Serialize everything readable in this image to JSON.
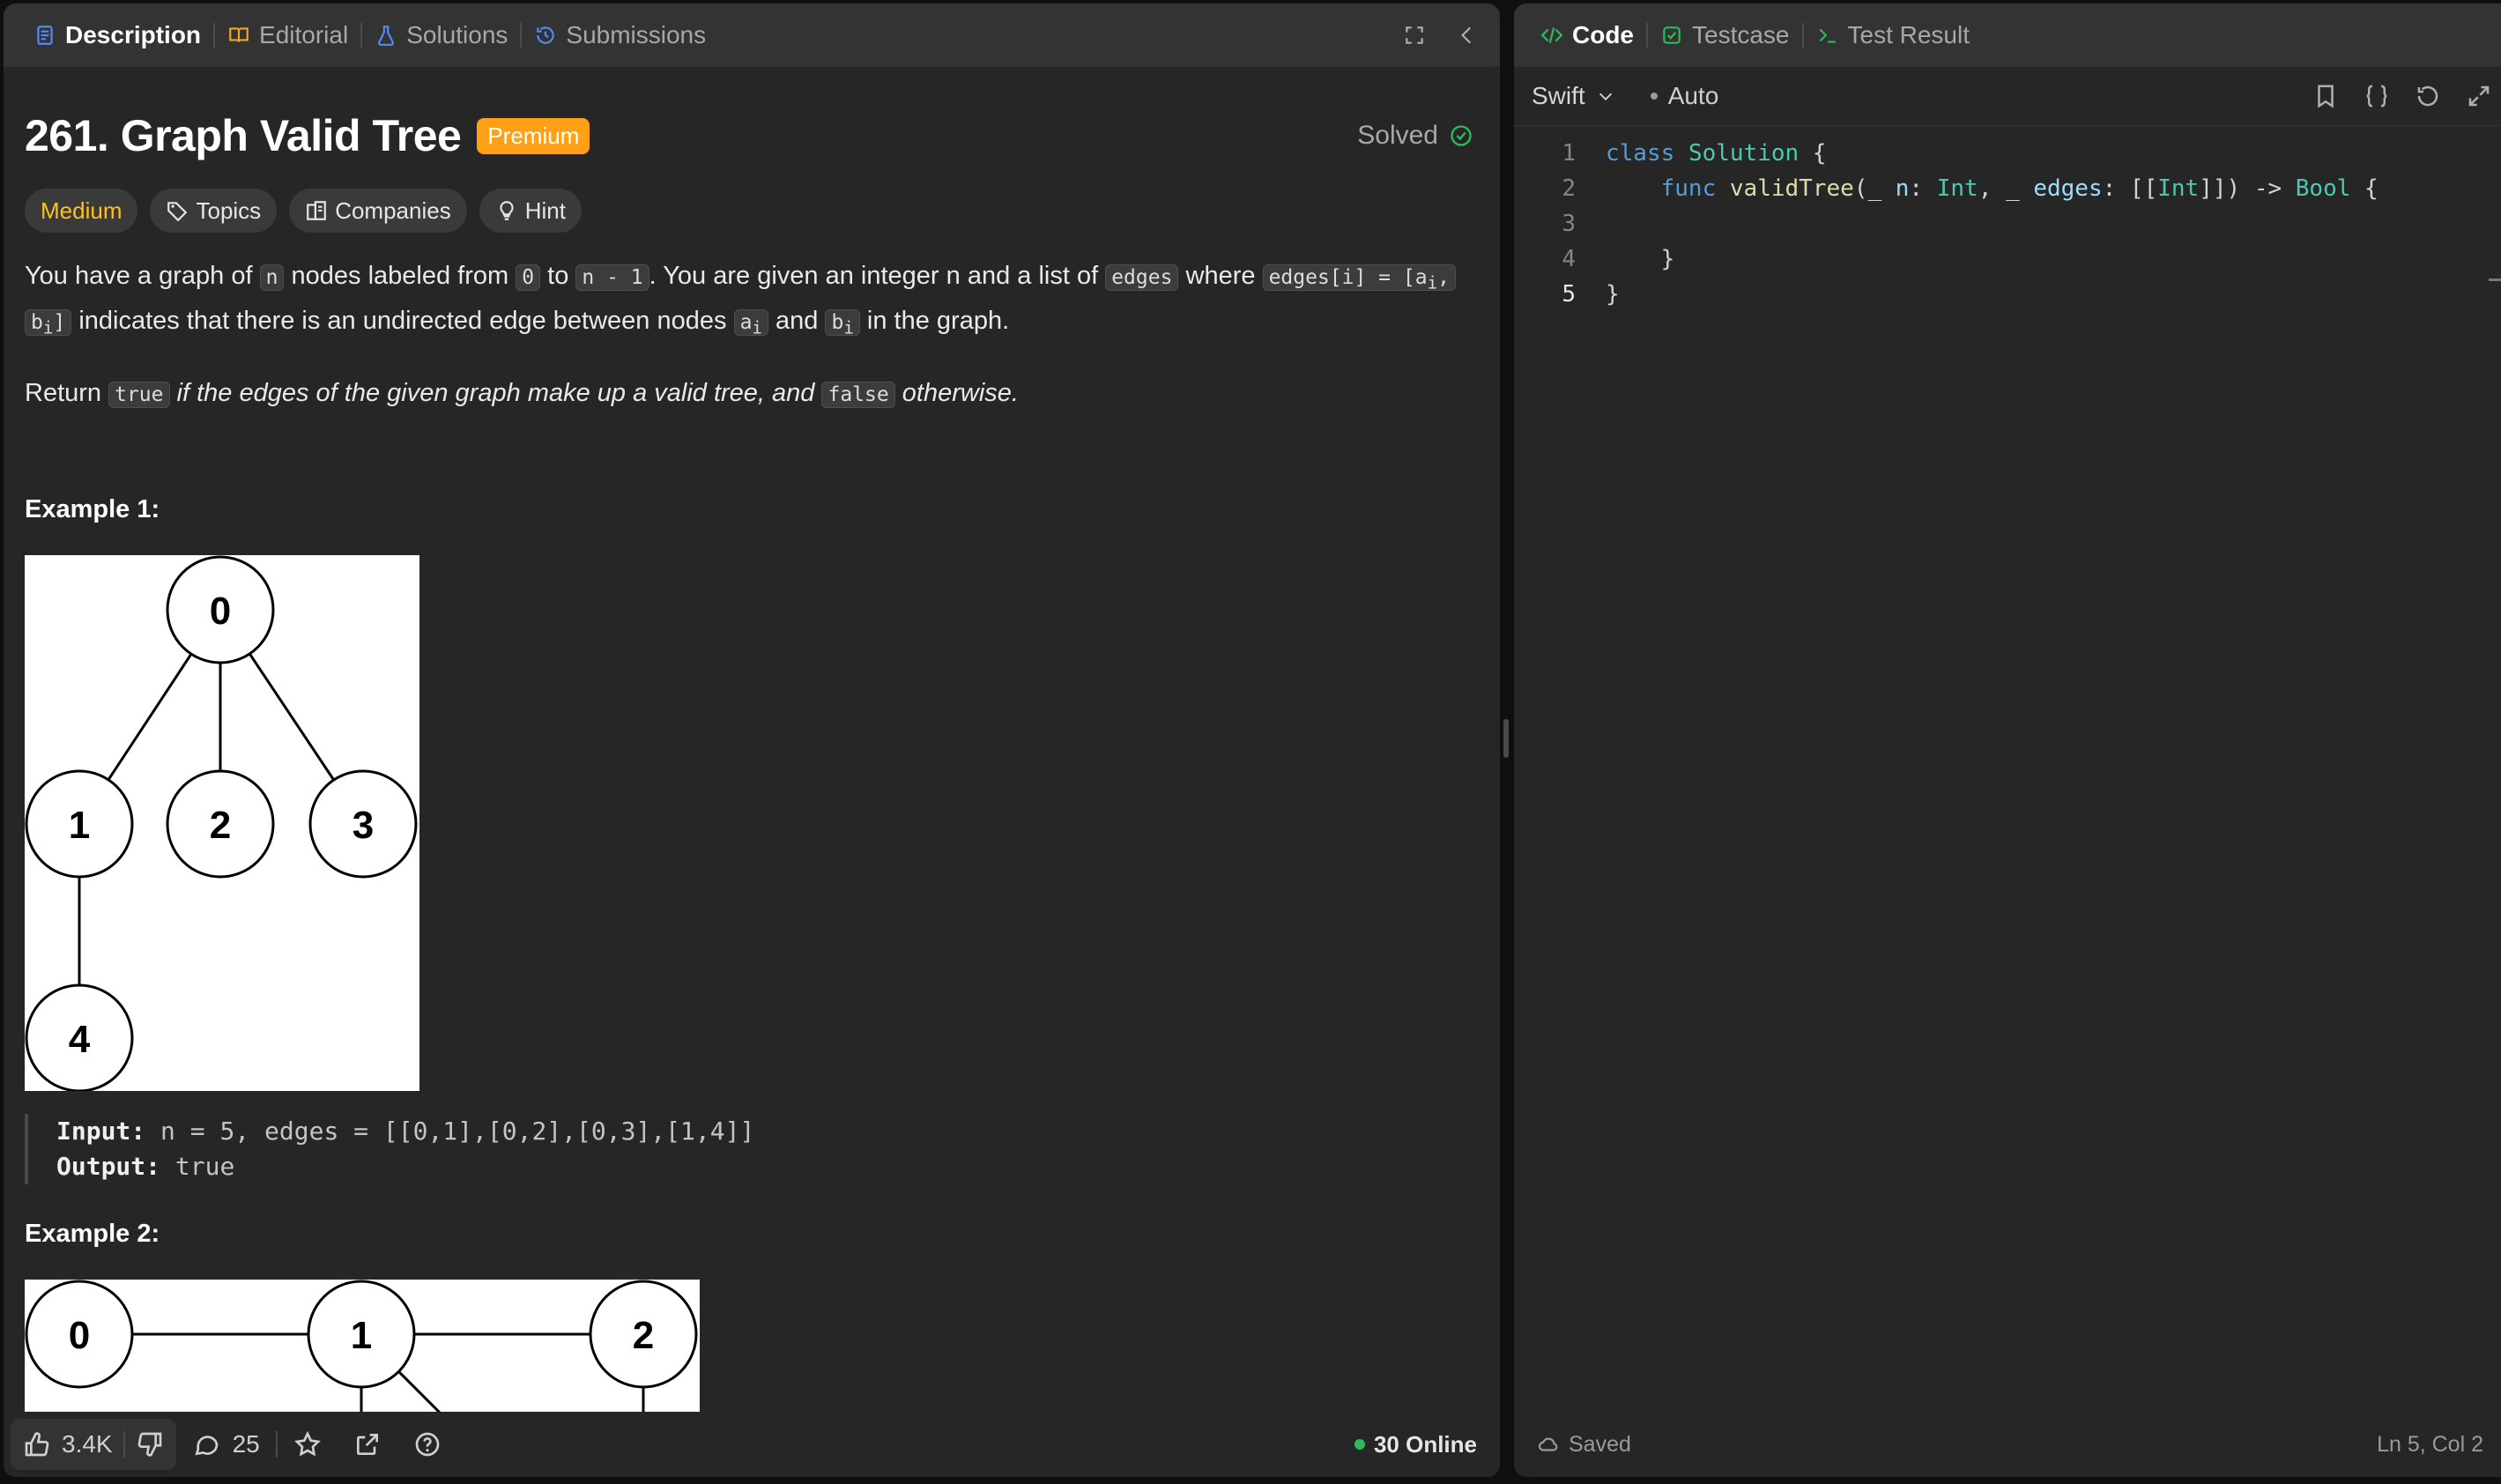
{
  "left_tabs": [
    {
      "label": "Description",
      "icon": "document-icon",
      "active": true
    },
    {
      "label": "Editorial",
      "icon": "book-icon"
    },
    {
      "label": "Solutions",
      "icon": "flask-icon"
    },
    {
      "label": "Submissions",
      "icon": "history-icon"
    }
  ],
  "problem": {
    "title": "261. Graph Valid Tree",
    "premium_label": "Premium",
    "status": "Solved",
    "difficulty": "Medium",
    "tags": [
      "Topics",
      "Companies",
      "Hint"
    ]
  },
  "description": {
    "p1": {
      "t1": "You have a graph of ",
      "c1": "n",
      "t2": " nodes labeled from ",
      "c2": "0",
      "t3": " to ",
      "c3": "n - 1",
      "t4": ". You are given an integer n and a list of ",
      "c4": "edges",
      "t5": " where ",
      "c5": "edges[i] = [a",
      "c5_sub": "i",
      "c5b": ",",
      "c6": "b",
      "c6_sub": "i",
      "c6b": "]",
      "t6": " indicates that there is an undirected edge between nodes ",
      "c7": "a",
      "c7_sub": "i",
      "t7": " and ",
      "c8": "b",
      "c8_sub": "i",
      "t8": " in the graph."
    },
    "p2": {
      "t1": "Return ",
      "c1": "true",
      "t2": " if the edges of the given graph make up a valid tree, and ",
      "c2": "false",
      "t3": " otherwise."
    }
  },
  "examples": [
    {
      "heading": "Example 1:",
      "nodes": [
        "0",
        "1",
        "2",
        "3",
        "4"
      ],
      "input_label": "Input:",
      "input_value": "n = 5, edges = [[0,1],[0,2],[0,3],[1,4]]",
      "output_label": "Output:",
      "output_value": "true"
    },
    {
      "heading": "Example 2:",
      "nodes": [
        "0",
        "1",
        "2"
      ]
    }
  ],
  "left_footer": {
    "likes": "3.4K",
    "comments": "25",
    "online": "30 Online"
  },
  "right_tabs": [
    {
      "label": "Code",
      "icon": "code-icon",
      "active": true
    },
    {
      "label": "Testcase",
      "icon": "checkbox-icon"
    },
    {
      "label": "Test Result",
      "icon": "terminal-icon"
    }
  ],
  "editor": {
    "language": "Swift",
    "mode": "Auto",
    "line_numbers": [
      "1",
      "2",
      "3",
      "4",
      "5"
    ],
    "status": "Saved",
    "cursor": "Ln 5, Col 2"
  },
  "colors": {
    "accent_orange": "#ffa116",
    "medium": "#ffc01e",
    "solved_green": "#2cbb5d",
    "keyword": "#569cd6",
    "type": "#4ec9b0"
  }
}
